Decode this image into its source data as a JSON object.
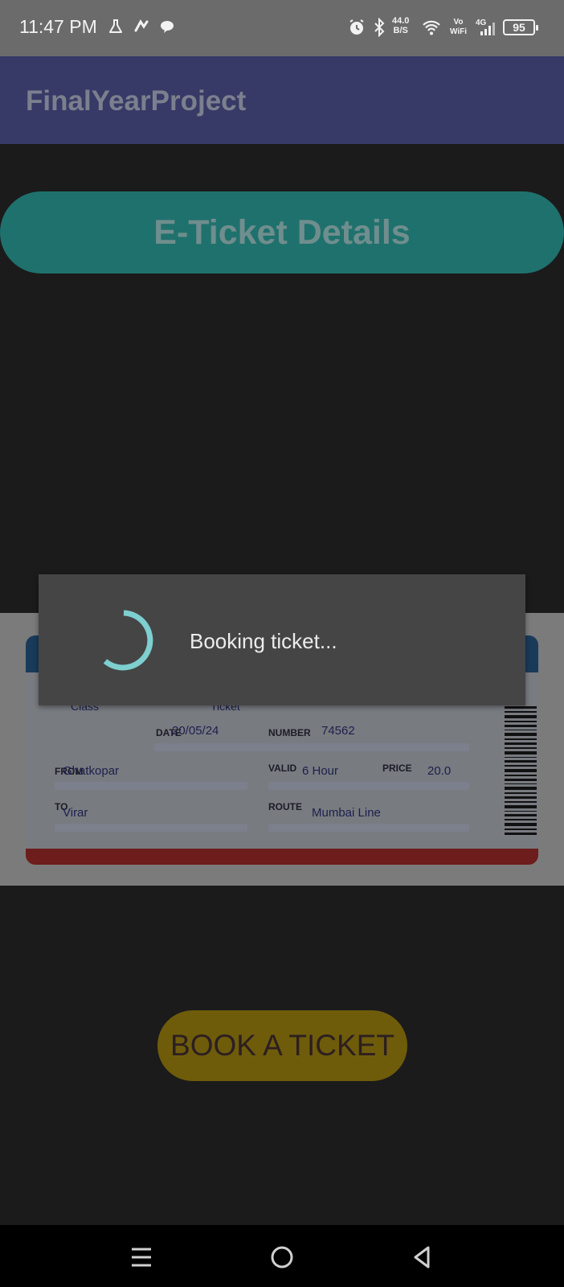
{
  "status_bar": {
    "time": "11:47 PM",
    "network_speed_value": "44.0",
    "network_speed_unit": "B/S",
    "vo_label": "Vo",
    "wifi_label": "WiFi",
    "signal_label": "4G",
    "battery": "95",
    "icons": [
      "flask-icon",
      "app-icon",
      "chat-bubble-icon",
      "alarm-icon",
      "bluetooth-icon",
      "wifi-icon",
      "signal-icon",
      "battery-icon"
    ]
  },
  "app_bar": {
    "title": "FinalYearProject"
  },
  "header": {
    "title": "E-Ticket Details"
  },
  "ticket": {
    "class_label": "Class",
    "ticket_label": "Ticket",
    "date_label": "DATE",
    "date_value": "20/05/24",
    "number_label": "NUMBER",
    "number_value": "74562",
    "from_label": "FROM",
    "from_value": "Ghatkopar",
    "valid_label": "VALID",
    "valid_value": "6 Hour",
    "price_label": "PRICE",
    "price_value": "20.0",
    "to_label": "TO",
    "to_value": "Virar",
    "route_label": "ROUTE",
    "route_value": "Mumbai Line"
  },
  "book_button": {
    "label": "BOOK A TICKET"
  },
  "dialog": {
    "message": "Booking ticket..."
  },
  "nav_bar": {
    "icons": [
      "menu-icon",
      "home-icon",
      "back-icon"
    ]
  },
  "colors": {
    "app_bar": "#373a66",
    "header_pill": "#1f716d",
    "book_button": "#6e5c0b",
    "spinner": "#7ecfcf",
    "dialog": "#454545"
  }
}
